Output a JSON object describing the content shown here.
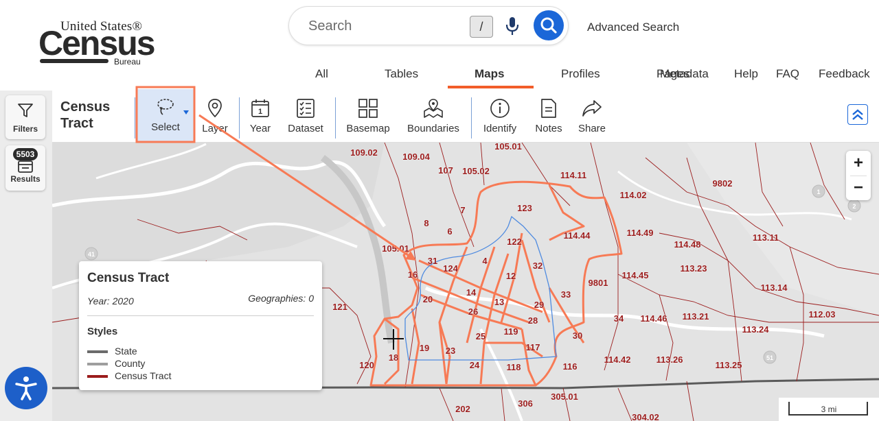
{
  "header": {
    "logo": {
      "line1": "United States®",
      "line2": "Census",
      "line3": "Bureau"
    },
    "search": {
      "placeholder": "Search",
      "shortcut": "/"
    },
    "advanced_search": "Advanced Search",
    "tabs": [
      "All",
      "Tables",
      "Maps",
      "Profiles",
      "Pages",
      "Metadata",
      "Help",
      "FAQ",
      "Feedback"
    ],
    "active_tab": "Maps"
  },
  "rail": {
    "filters_label": "Filters",
    "results_label": "Results",
    "results_count": "5503"
  },
  "toolbar": {
    "title_line1": "Census",
    "title_line2": "Tract",
    "tools": [
      {
        "label": "Select",
        "icon": "lasso-select-icon"
      },
      {
        "label": "Layer",
        "icon": "map-pin-icon"
      },
      {
        "label": "Year",
        "icon": "calendar-icon"
      },
      {
        "label": "Dataset",
        "icon": "checklist-icon"
      },
      {
        "label": "Basemap",
        "icon": "grid-icon"
      },
      {
        "label": "Boundaries",
        "icon": "map-location-icon"
      },
      {
        "label": "Identify",
        "icon": "info-icon"
      },
      {
        "label": "Notes",
        "icon": "note-icon"
      },
      {
        "label": "Share",
        "icon": "share-icon"
      }
    ]
  },
  "map": {
    "tract_labels": [
      "109.02",
      "109.04",
      "105.01",
      "107",
      "105.02",
      "114.11",
      "9802",
      "114.02",
      "7",
      "123",
      "8",
      "6",
      "122",
      "114.44",
      "114.49",
      "114.48",
      "113.11",
      "105.01",
      "31",
      "4",
      "124",
      "16",
      "32",
      "12",
      "9801",
      "114.45",
      "113.23",
      "14",
      "13",
      "33",
      "113.14",
      "20",
      "29",
      "121",
      "26",
      "28",
      "34",
      "114.46",
      "113.21",
      "112.03",
      "25",
      "119",
      "30",
      "113.24",
      "117",
      "19",
      "23",
      "18",
      "120",
      "24",
      "118",
      "116",
      "114.42",
      "113.26",
      "113.25",
      "202",
      "306",
      "305.01",
      "304.02"
    ],
    "highway_shields": [
      "41",
      "1",
      "2",
      "51"
    ],
    "scale_label": "3 mi",
    "zoom_in": "+",
    "zoom_out": "−"
  },
  "legend": {
    "title": "Census Tract",
    "year": "Year: 2020",
    "geographies": "Geographies: 0",
    "styles_heading": "Styles",
    "items": [
      {
        "label": "State",
        "color": "#6b6b6b"
      },
      {
        "label": "County",
        "color": "#9e9e9e"
      },
      {
        "label": "Census Tract",
        "color": "#9b1c1c"
      }
    ]
  },
  "colors": {
    "accent": "#f25d2a",
    "brand_blue": "#1b67d8",
    "tract_label": "#9b1c1c",
    "selection_outline": "#f77a55"
  }
}
